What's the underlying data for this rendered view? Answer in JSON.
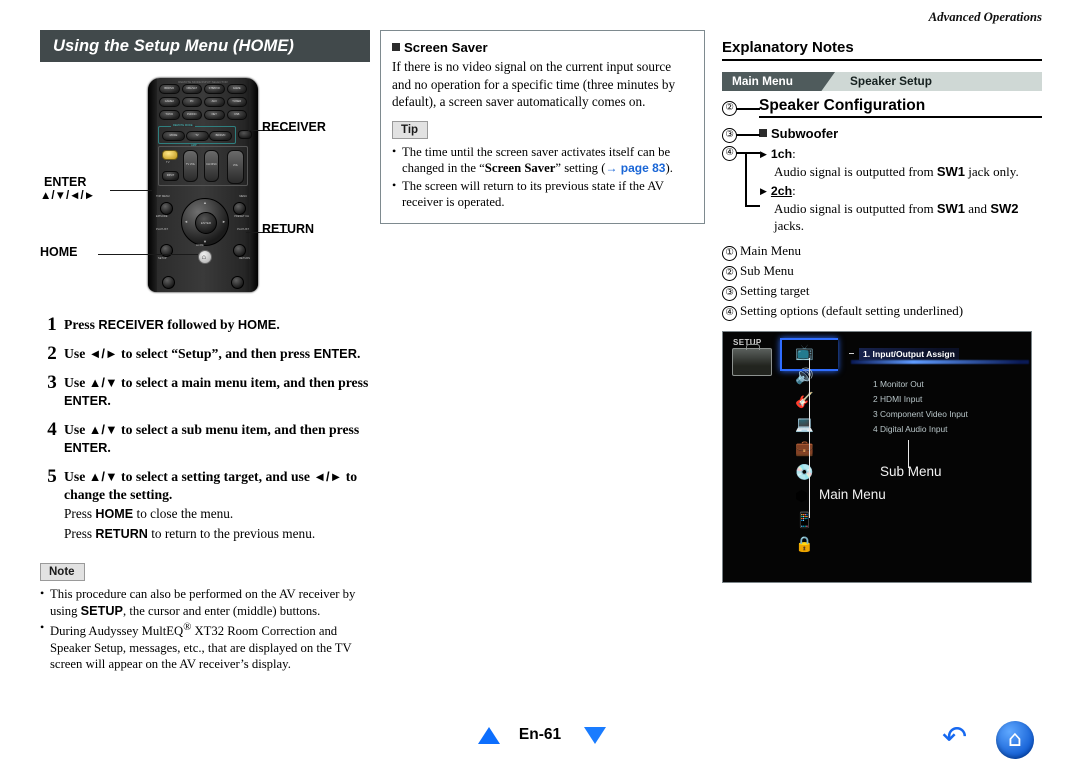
{
  "running_head": "Advanced Operations",
  "left": {
    "section_title": "Using the Setup Menu (HOME)",
    "remote": {
      "top_label": "REMOTE MODE/INPUT SELECTOR",
      "source_buttons": [
        "BD/DVD",
        "CBL/SAT",
        "STB/DVR",
        "GAME",
        "GAME2",
        "PC",
        "AUX",
        "TUNER",
        "TV/CD",
        "PHONO",
        "NET",
        "USB"
      ],
      "remote_mode_label": "REMOTE MODE",
      "amp_label": "AMP",
      "mode_buttons": [
        "MODE",
        "TV",
        "BD/DVD"
      ],
      "receiver_button": "RECEIVER",
      "power_label": "TV",
      "input_button": "INPUT",
      "tv_vol_label": "TV VOL",
      "ch_disc_label": "CH DISC",
      "album_label": "ALBUM",
      "vol_label": "VOL",
      "top_menu_label": "TOP MENU",
      "menu_label": "MENU",
      "episode_label": "EPISODE",
      "presetch_label": "PRESET CH",
      "playlist_left_label": "PLAYLIST",
      "playlist_right_label": "PLAYLIST",
      "enter_label": "ENTER",
      "setup_label": "SETUP",
      "home_label": "HOME",
      "return_label": "RETURN",
      "q_label": "Q"
    },
    "callouts": {
      "receiver": "RECEIVER",
      "enter": "ENTER",
      "arrows": "▲/▼/◄/►",
      "home": "HOME",
      "return": "RETURN"
    },
    "steps": [
      {
        "num": "1",
        "parts": [
          {
            "t": "Press ",
            "s": "serif"
          },
          {
            "t": "RECEIVER",
            "s": "sans"
          },
          {
            "t": " followed by ",
            "s": "serif"
          },
          {
            "t": "HOME",
            "s": "sans"
          },
          {
            "t": ".",
            "s": "serif"
          }
        ]
      },
      {
        "num": "2",
        "parts": [
          {
            "t": "Use ",
            "s": "serif"
          },
          {
            "t": "◄/►",
            "s": "sans"
          },
          {
            "t": " to select “Setup”, and then press ",
            "s": "serif"
          },
          {
            "t": "ENTER",
            "s": "sans"
          },
          {
            "t": ".",
            "s": "serif"
          }
        ]
      },
      {
        "num": "3",
        "parts": [
          {
            "t": "Use ",
            "s": "serif"
          },
          {
            "t": "▲/▼",
            "s": "sans"
          },
          {
            "t": " to select a main menu item, and then press ",
            "s": "serif"
          },
          {
            "t": "ENTER",
            "s": "sans"
          },
          {
            "t": ".",
            "s": "serif"
          }
        ]
      },
      {
        "num": "4",
        "parts": [
          {
            "t": "Use ",
            "s": "serif"
          },
          {
            "t": "▲/▼",
            "s": "sans"
          },
          {
            "t": " to select a sub menu item, and then press ",
            "s": "serif"
          },
          {
            "t": "ENTER",
            "s": "sans"
          },
          {
            "t": ".",
            "s": "serif"
          }
        ]
      },
      {
        "num": "5",
        "parts": [
          {
            "t": "Use ",
            "s": "serif"
          },
          {
            "t": "▲/▼",
            "s": "sans"
          },
          {
            "t": " to select a setting target, and use ",
            "s": "serif"
          },
          {
            "t": "◄/►",
            "s": "sans"
          },
          {
            "t": " to change the setting.",
            "s": "serif"
          }
        ],
        "sub": [
          [
            {
              "t": "Press ",
              "s": "serif-n"
            },
            {
              "t": "HOME",
              "s": "sans"
            },
            {
              "t": " to close the menu.",
              "s": "serif-n"
            }
          ],
          [
            {
              "t": "Press ",
              "s": "serif-n"
            },
            {
              "t": "RETURN",
              "s": "sans"
            },
            {
              "t": " to return to the previous menu.",
              "s": "serif-n"
            }
          ]
        ]
      }
    ],
    "note": {
      "tag": "Note",
      "items": [
        [
          {
            "t": "This procedure can also be performed on the AV receiver by using ",
            "s": "serif-n"
          },
          {
            "t": "SETUP",
            "s": "sans"
          },
          {
            "t": ", the cursor and enter (middle) buttons.",
            "s": "serif-n"
          }
        ],
        [
          {
            "t": "During Audyssey MultEQ® XT32 Room Correction and Speaker Setup, messages, etc., that are displayed on the TV screen will appear on the AV receiver’s display.",
            "s": "serif-n"
          }
        ]
      ]
    }
  },
  "middle": {
    "heading": "Screen Saver",
    "body": "If there is no video signal on the current input source and no operation for a specific time (three minutes by default), a screen saver automatically comes on.",
    "tip": {
      "tag": "Tip",
      "items": [
        [
          {
            "t": "The time until the screen saver activates itself can be changed in the “",
            "s": "serif-n"
          },
          {
            "t": "Screen Saver",
            "s": "serif-b"
          },
          {
            "t": "” setting (",
            "s": "serif-n"
          },
          {
            "t": "→ page 83",
            "s": "link"
          },
          {
            "t": ").",
            "s": "serif-n"
          }
        ],
        [
          {
            "t": "The screen will return to its previous state if the AV receiver is operated.",
            "s": "serif-n"
          }
        ]
      ]
    }
  },
  "right": {
    "heading": "Explanatory Notes",
    "crumb": {
      "main": "Main Menu",
      "sub": "Speaker Setup"
    },
    "markers": {
      "one": "①",
      "two": "②",
      "three": "③",
      "four": "④"
    },
    "sub_config": "Speaker Configuration",
    "setting_target": "Subwoofer",
    "options": [
      {
        "label": "1ch",
        "underlined": false,
        "desc": [
          {
            "t": "Audio signal is outputted from ",
            "s": "serif-n"
          },
          {
            "t": "SW1",
            "s": "sans"
          },
          {
            "t": " jack only.",
            "s": "serif-n"
          }
        ]
      },
      {
        "label": "2ch",
        "underlined": true,
        "desc": [
          {
            "t": "Audio signal is outputted from ",
            "s": "serif-n"
          },
          {
            "t": "SW1",
            "s": "sans"
          },
          {
            "t": " and ",
            "s": "serif-n"
          },
          {
            "t": "SW2",
            "s": "sans"
          },
          {
            "t": " jacks.",
            "s": "serif-n"
          }
        ]
      }
    ],
    "legend": [
      {
        "marker": "①",
        "text": "Main Menu"
      },
      {
        "marker": "②",
        "text": "Sub Menu"
      },
      {
        "marker": "③",
        "text": "Setting target"
      },
      {
        "marker": "④",
        "text": "Setting options (default setting underlined)"
      }
    ],
    "tvshot": {
      "setup_word": "SETUP",
      "submenu_title": "1. Input/Output Assign",
      "submenu_items": [
        "1 Monitor Out",
        "2 HDMI Input",
        "3 Component Video Input",
        "4 Digital Audio Input"
      ],
      "label_main_menu": "Main Menu",
      "label_sub_menu": "Sub Menu",
      "menu_icons": [
        "input-output-assign-icon",
        "speaker-setup-icon",
        "audio-adjust-icon",
        "source-setup-icon",
        "listening-mode-preset-icon",
        "miscellaneous-icon",
        "hardware-setup-icon",
        "remote-controller-setup-icon",
        "lock-setup-icon"
      ]
    }
  },
  "footer": {
    "page": "En-61",
    "prev_icon": "triangle-up-icon",
    "next_icon": "triangle-down-icon",
    "back_icon": "back-arrow-icon",
    "home_icon": "home-icon",
    "back_glyph": "↶",
    "home_glyph": "⌂"
  },
  "colors": {
    "header_bg": "#41494b",
    "crumb_main": "#4f5b5c",
    "crumb_bar": "#cfd8d5",
    "link_blue": "#1a66d6",
    "nav_blue": "#0d6efd"
  }
}
